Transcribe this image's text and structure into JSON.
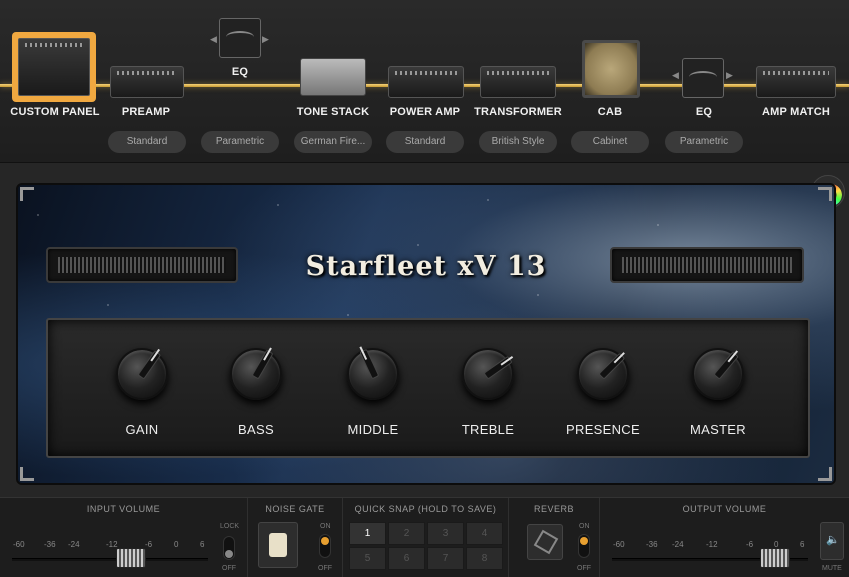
{
  "chain": {
    "modules": [
      {
        "id": "custom_panel",
        "label": "CUSTOM PANEL",
        "selected": true
      },
      {
        "id": "preamp",
        "label": "PREAMP",
        "type": "Standard"
      },
      {
        "id": "eq1",
        "label": "EQ",
        "type": "Parametric"
      },
      {
        "id": "tone_stack",
        "label": "TONE STACK",
        "type": "German Fire..."
      },
      {
        "id": "power_amp",
        "label": "POWER AMP",
        "type": "Standard"
      },
      {
        "id": "transformer",
        "label": "TRANSFORMER",
        "type": "British Style"
      },
      {
        "id": "cab",
        "label": "CAB",
        "type": "Cabinet"
      },
      {
        "id": "eq2",
        "label": "EQ",
        "type": "Parametric"
      },
      {
        "id": "amp_match",
        "label": "AMP MATCH"
      }
    ],
    "accent_color": "#f0b13a"
  },
  "amp": {
    "title": "Starfleet xV 13",
    "knobs": [
      {
        "label": "GAIN",
        "rotation_deg": 35
      },
      {
        "label": "BASS",
        "rotation_deg": 30
      },
      {
        "label": "MIDDLE",
        "rotation_deg": -25
      },
      {
        "label": "TREBLE",
        "rotation_deg": 55
      },
      {
        "label": "PRESENCE",
        "rotation_deg": 45
      },
      {
        "label": "MASTER",
        "rotation_deg": 40
      }
    ]
  },
  "bottom": {
    "input_volume": {
      "title": "INPUT VOLUME",
      "scale": [
        "-60",
        "-36",
        "-24",
        "-12",
        "-6",
        "0",
        "6"
      ],
      "lock_label": "LOCK",
      "lock_state": "OFF"
    },
    "noise_gate": {
      "title": "NOISE GATE",
      "on_label": "ON",
      "off_label": "OFF"
    },
    "quick_snap": {
      "title": "QUICK SNAP (HOLD TO SAVE)",
      "slots": [
        "1",
        "2",
        "3",
        "4",
        "5",
        "6",
        "7",
        "8"
      ],
      "active": "1"
    },
    "reverb": {
      "title": "REVERB",
      "on_label": "ON",
      "off_label": "OFF"
    },
    "output_volume": {
      "title": "OUTPUT VOLUME",
      "scale": [
        "-60",
        "-36",
        "-24",
        "-12",
        "-6",
        "0",
        "6"
      ],
      "mute_label": "MUTE"
    }
  }
}
